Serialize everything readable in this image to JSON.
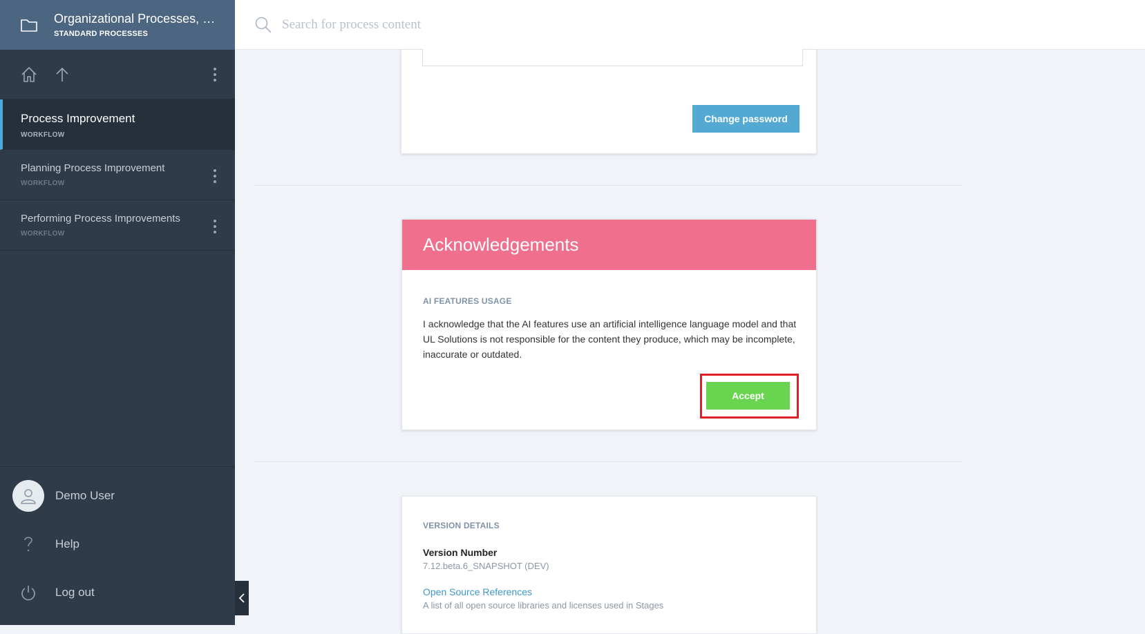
{
  "sidebar": {
    "header": {
      "title": "Organizational Processes, R...",
      "subtitle": "STANDARD PROCESSES"
    },
    "items": [
      {
        "label": "Process Improvement",
        "sub": "WORKFLOW",
        "active": true
      },
      {
        "label": "Planning Process Improvement",
        "sub": "WORKFLOW"
      },
      {
        "label": "Performing Process Improvements",
        "sub": "WORKFLOW"
      }
    ],
    "bottom": {
      "user": "Demo User",
      "help": "Help",
      "logout": "Log out"
    }
  },
  "search": {
    "placeholder": "Search for process content",
    "value": ""
  },
  "password_card": {
    "change_button": "Change password"
  },
  "acknowledgements": {
    "title": "Acknowledgements",
    "section_label": "AI FEATURES USAGE",
    "text": "I acknowledge that the AI features use an artificial intelligence language model and that UL Solutions is not responsible for the content they produce, which may be incomplete, inaccurate or outdated.",
    "accept_button": "Accept"
  },
  "version": {
    "section_label": "VERSION DETAILS",
    "number_label": "Version Number",
    "number_value": "7.12.beta.6_SNAPSHOT (DEV)",
    "oss_link": "Open Source References",
    "oss_desc": "A list of all open source libraries and licenses used in Stages"
  },
  "colors": {
    "sidebar_bg": "#2f3b48",
    "header_bg": "#4c6580",
    "accent_blue": "#54a9d2",
    "ack_pink": "#ef6f8c",
    "accept_green": "#69d44f",
    "highlight_red": "#e01f26"
  },
  "icons": [
    "folder-icon",
    "home-icon",
    "arrow-up-icon",
    "kebab-icon",
    "search-icon",
    "user-icon",
    "help-icon",
    "power-icon",
    "chevron-left-icon"
  ]
}
